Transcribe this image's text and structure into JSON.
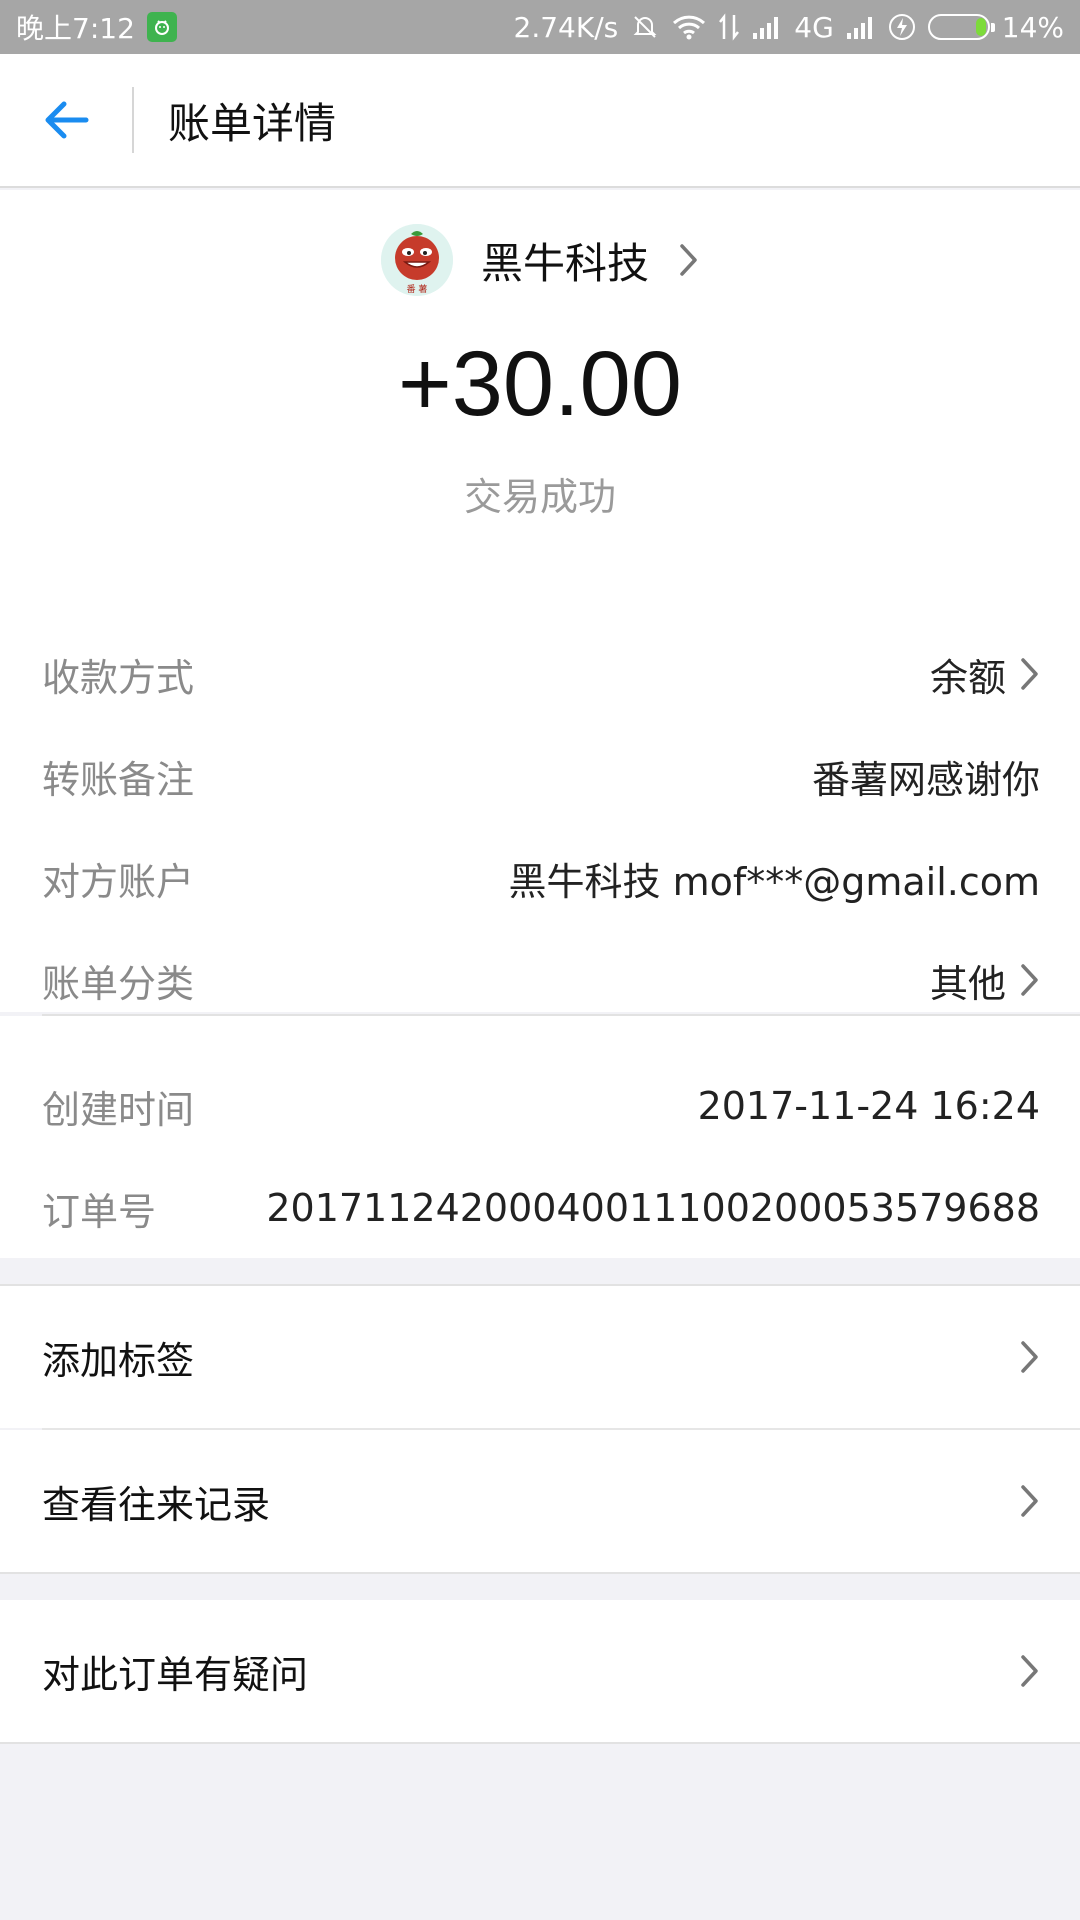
{
  "status_bar": {
    "time": "晚上7:12",
    "network_speed": "2.74K/s",
    "network_type": "4G",
    "battery": "14%",
    "battery_level": 0.14
  },
  "header": {
    "title": "账单详情"
  },
  "summary": {
    "merchant_name": "黑牛科技",
    "amount": "+30.00",
    "status": "交易成功"
  },
  "details": [
    {
      "label": "收款方式",
      "value": "余额",
      "has_chevron": true
    },
    {
      "label": "转账备注",
      "value": "番薯网感谢你",
      "has_chevron": false
    },
    {
      "label": "对方账户",
      "value": "黑牛科技 mof***@gmail.com",
      "has_chevron": false
    },
    {
      "label": "账单分类",
      "value": "其他",
      "has_chevron": true
    }
  ],
  "meta": [
    {
      "label": "创建时间",
      "value": "2017-11-24 16:24"
    },
    {
      "label": "订单号",
      "value": "20171124200040011100200053579688"
    }
  ],
  "actions": [
    {
      "label": "添加标签"
    },
    {
      "label": "查看往来记录"
    },
    {
      "label": "对此订单有疑问"
    }
  ],
  "colors": {
    "accent": "#1a8cf0",
    "status_bar": "#a6a6a6",
    "background": "#f2f2f6"
  }
}
